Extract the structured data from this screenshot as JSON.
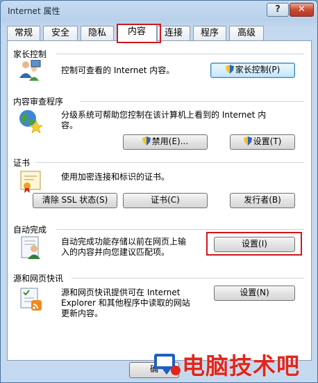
{
  "window": {
    "title": "Internet 属性",
    "help_label": "?",
    "close_label": "✕"
  },
  "tabs": [
    {
      "label": "常规"
    },
    {
      "label": "安全"
    },
    {
      "label": "隐私"
    },
    {
      "label": "内容"
    },
    {
      "label": "连接"
    },
    {
      "label": "程序"
    },
    {
      "label": "高级"
    }
  ],
  "active_tab": "内容",
  "groups": {
    "parental": {
      "title": "家长控制",
      "desc": "控制可查看的 Internet 内容。",
      "button": "家长控制(P)"
    },
    "advisor": {
      "title": "内容审查程序",
      "desc_line1": "分级系统可帮助您控制在该计算机上看到的 Internet 内",
      "desc_line2": "容。",
      "enable_button": "禁用(E)...",
      "settings_button": "设置(T)"
    },
    "certificates": {
      "title": "证书",
      "desc": "使用加密连接和标识的证书。",
      "clear_ssl_button": "清除 SSL 状态(S)",
      "certs_button": "证书(C)",
      "publishers_button": "发行者(B)"
    },
    "autocomplete": {
      "title": "自动完成",
      "desc_line1": "自动完成功能存储以前在网页上输",
      "desc_line2": "入的内容并向您建议匹配项。",
      "settings_button": "设置(I)"
    },
    "feeds": {
      "title": "源和网页快讯",
      "desc_line1": "源和网页快讯提供可在 Internet",
      "desc_line2": "Explorer 和其他程序中读取的网站",
      "desc_line3": "更新内容。",
      "settings_button": "设置(N)"
    }
  },
  "footer": {
    "ok_button": "确"
  },
  "watermark": {
    "text": "电脑技术吧"
  },
  "colors": {
    "highlight": "#d0161b",
    "watermark": "#e1261c",
    "panel": "#ffffff"
  }
}
